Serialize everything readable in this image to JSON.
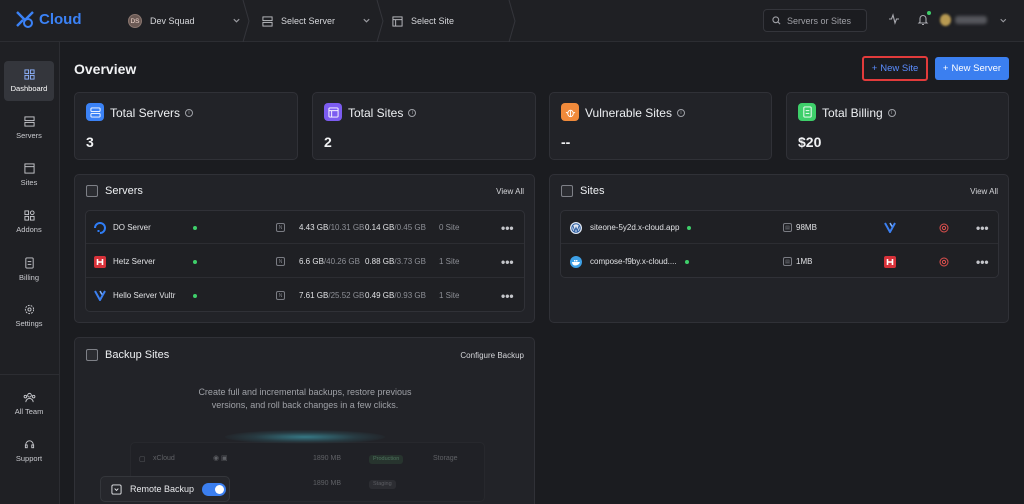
{
  "brand": {
    "name": "Cloud",
    "color": "#3b82f6"
  },
  "topbar": {
    "team": {
      "initials": "DS",
      "name": "Dev Squad"
    },
    "server_select": "Select Server",
    "site_select": "Select Site",
    "search_placeholder": "Servers or Sites"
  },
  "sidebar": {
    "items": [
      {
        "label": "Dashboard",
        "icon": "dashboard-icon",
        "active": true
      },
      {
        "label": "Servers",
        "icon": "servers-icon"
      },
      {
        "label": "Sites",
        "icon": "sites-icon"
      },
      {
        "label": "Addons",
        "icon": "addons-icon"
      },
      {
        "label": "Billing",
        "icon": "billing-icon"
      },
      {
        "label": "Settings",
        "icon": "settings-icon"
      },
      {
        "label": "All Team",
        "icon": "team-icon"
      },
      {
        "label": "Support",
        "icon": "support-icon"
      }
    ]
  },
  "main": {
    "title": "Overview",
    "new_site": "New Site",
    "new_server": "New Server",
    "stats": [
      {
        "label": "Total Servers",
        "value": "3",
        "color": "#3b82f6"
      },
      {
        "label": "Total Sites",
        "value": "2",
        "color": "#7c5cf0"
      },
      {
        "label": "Vulnerable Sites",
        "value": "--",
        "color": "#f08a3b"
      },
      {
        "label": "Total Billing",
        "value": "$20",
        "color": "#3ecf6a"
      }
    ],
    "servers": {
      "title": "Servers",
      "view_all": "View All",
      "rows": [
        {
          "name": "DO Server",
          "ram": "4.43 GB",
          "ram_total": "/10.31 GB",
          "disk": "0.14 GB",
          "disk_total": "/0.45 GB",
          "sites": "0 Site"
        },
        {
          "name": "Hetz Server",
          "ram": "6.6 GB",
          "ram_total": "/40.26 GB",
          "disk": "0.88 GB",
          "disk_total": "/3.73 GB",
          "sites": "1 Site"
        },
        {
          "name": "Hello Server Vultr",
          "ram": "7.61 GB",
          "ram_total": "/25.52 GB",
          "disk": "0.49 GB",
          "disk_total": "/0.93 GB",
          "sites": "1 Site"
        }
      ]
    },
    "sites": {
      "title": "Sites",
      "view_all": "View All",
      "rows": [
        {
          "name": "siteone-5y2d.x-cloud.app",
          "size": "98MB"
        },
        {
          "name": "compose-f9by.x-cloud....",
          "size": "1MB"
        }
      ]
    },
    "backup": {
      "title": "Backup Sites",
      "configure": "Configure Backup",
      "desc_line1": "Create full and incremental backups, restore previous",
      "desc_line2": "versions, and roll back changes in a few clicks.",
      "preview_rows": [
        {
          "name": "xCloud",
          "size": "1890 MB",
          "tag": "Production",
          "extra": "Storage"
        },
        {
          "name": "",
          "size": "1890 MB",
          "tag": "Staging",
          "extra": ""
        }
      ],
      "remote_label": "Remote Backup"
    }
  }
}
